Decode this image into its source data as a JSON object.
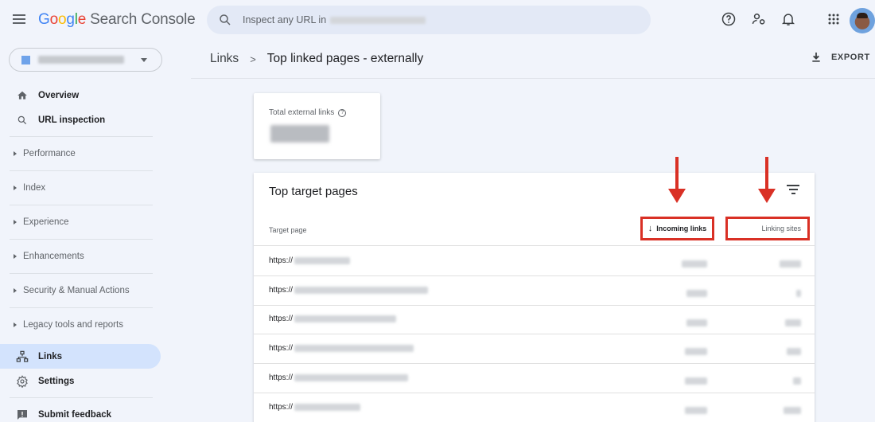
{
  "header": {
    "app_name_google": [
      "G",
      "o",
      "o",
      "g",
      "l",
      "e"
    ],
    "app_name_product": "Search Console",
    "search_placeholder": "Inspect any URL in",
    "search_property_redacted": true
  },
  "property_selector": {
    "value_redacted": true
  },
  "sidebar": {
    "top_items": [
      {
        "label": "Overview",
        "icon": "home-icon"
      },
      {
        "label": "URL inspection",
        "icon": "search-icon"
      }
    ],
    "sections": [
      {
        "label": "Performance"
      },
      {
        "label": "Index"
      },
      {
        "label": "Experience"
      },
      {
        "label": "Enhancements"
      },
      {
        "label": "Security & Manual Actions"
      },
      {
        "label": "Legacy tools and reports"
      }
    ],
    "bottom_items": [
      {
        "label": "Links",
        "icon": "links-icon",
        "active": true
      },
      {
        "label": "Settings",
        "icon": "gear-icon"
      },
      {
        "label": "Submit feedback",
        "icon": "feedback-icon"
      }
    ]
  },
  "breadcrumb": {
    "parent": "Links",
    "separator": ">",
    "current": "Top linked pages - externally"
  },
  "export_label": "EXPORT",
  "summary": {
    "title": "Total external links",
    "value_redacted": true
  },
  "table": {
    "title": "Top target pages",
    "columns": {
      "target_page": "Target page",
      "incoming_links": "Incoming links",
      "linking_sites": "Linking sites"
    },
    "sort": {
      "column": "incoming_links",
      "direction": "descending",
      "icon": "arrow-down-icon"
    },
    "rows": [
      {
        "url_prefix": "https://",
        "url_redacted": true,
        "incoming_redacted": true,
        "sites_redacted": true
      },
      {
        "url_prefix": "https://",
        "url_redacted": true,
        "incoming_redacted": true,
        "sites_redacted": true
      },
      {
        "url_prefix": "https://",
        "url_redacted": true,
        "incoming_redacted": true,
        "sites_redacted": true
      },
      {
        "url_prefix": "https://",
        "url_redacted": true,
        "incoming_redacted": true,
        "sites_redacted": true
      },
      {
        "url_prefix": "https://",
        "url_redacted": true,
        "incoming_redacted": true,
        "sites_redacted": true
      },
      {
        "url_prefix": "https://",
        "url_redacted": true,
        "incoming_redacted": true,
        "sites_redacted": true
      }
    ]
  },
  "annotations": {
    "color": "#d93025",
    "highlighted_columns": [
      "Incoming links",
      "Linking sites"
    ]
  }
}
